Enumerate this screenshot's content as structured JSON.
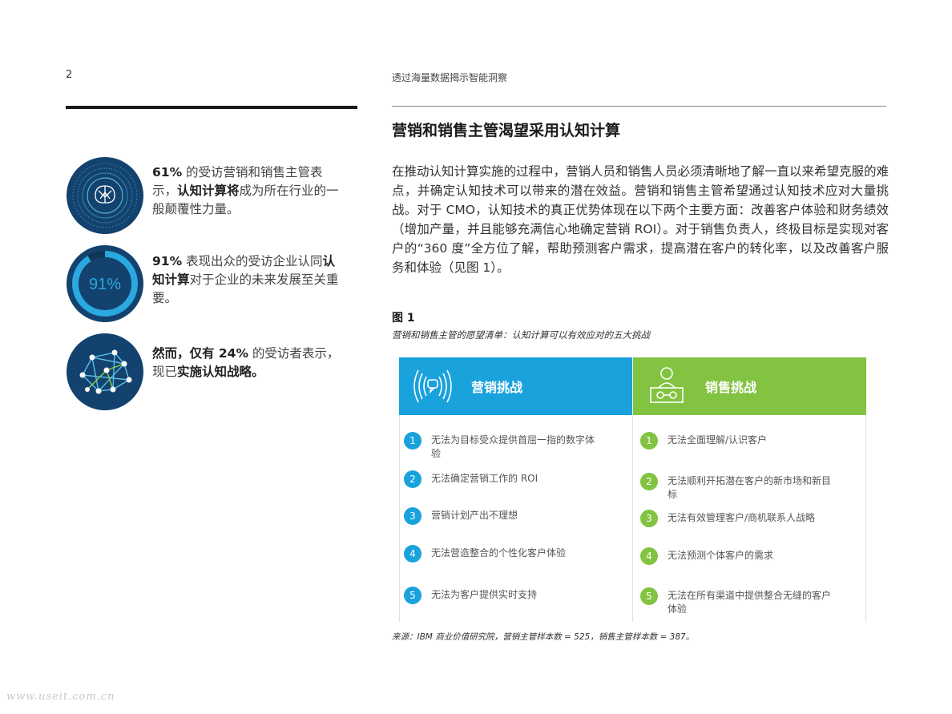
{
  "header": {
    "page_number": "2",
    "running_title": "透过海量数据揭示智能洞察"
  },
  "stats": [
    {
      "icon_label": "",
      "lead": "61%",
      "text_a": " 的受访营销和销售主管表示，",
      "bold": "认知计算将",
      "text_b": "成为所在行业的一般颠覆性力量。",
      "icon": "brain-icon"
    },
    {
      "icon_label": "91%",
      "lead": "91%",
      "text_a": " 表现出众的受访企业认同",
      "bold": "认知计算",
      "text_b": "对于企业的未来发展至关重要。",
      "icon": "progress-ring-icon",
      "ring_fraction": 0.91
    },
    {
      "icon_label": "",
      "lead": "然而，仅有 24%",
      "text_a": " 的受访者表示，现已",
      "bold": "实施认知战略。",
      "text_b": "",
      "icon": "network-icon"
    }
  ],
  "section": {
    "title": "营销和销售主管渴望采用认知计算",
    "body": "在推动认知计算实施的过程中，营销人员和销售人员必须清晰地了解一直以来希望克服的难点，并确定认知技术可以带来的潜在效益。营销和销售主管希望通过认知技术应对大量挑战。对于 CMO，认知技术的真正优势体现在以下两个主要方面：改善客户体验和财务绩效（增加产量，并且能够充满信心地确定营销 ROI）。对于销售负责人，终极目标是实现对客户的“360 度”全方位了解，帮助预测客户需求，提高潜在客户的转化率，以及改善客户服务和体验（见图 1）。"
  },
  "figure": {
    "label": "图 1",
    "caption": "营销和销售主管的愿望清单：认知计算可以有效应对的五大挑战",
    "marketing": {
      "title": "营销挑战",
      "icon": "speech-bubble-icon",
      "items": [
        {
          "n": "1",
          "text": "无法为目标受众提供首屈一指的数字体验"
        },
        {
          "n": "2",
          "text": "无法确定营销工作的 ROI"
        },
        {
          "n": "3",
          "text": "营销计划产出不理想"
        },
        {
          "n": "4",
          "text": "无法营造整合的个性化客户体验"
        },
        {
          "n": "5",
          "text": "无法为客户提供实时支持"
        }
      ]
    },
    "sales": {
      "title": "销售挑战",
      "icon": "salesperson-icon",
      "items": [
        {
          "n": "1",
          "text": "无法全面理解/认识客户"
        },
        {
          "n": "2",
          "text": "无法顺利开拓潜在客户的新市场和新目标"
        },
        {
          "n": "3",
          "text": "无法有效管理客户/商机联系人战略"
        },
        {
          "n": "4",
          "text": "无法预测个体客户的需求"
        },
        {
          "n": "5",
          "text": "无法在所有渠道中提供整合无缝的客户体验"
        }
      ]
    },
    "source": "来源：IBM 商业价值研究院，营销主管样本数 = 525，销售主管样本数 = 387。"
  },
  "watermark": "www.useit.com.cn",
  "colors": {
    "navy": "#13426e",
    "blue": "#1aa2dc",
    "green": "#82c341"
  }
}
